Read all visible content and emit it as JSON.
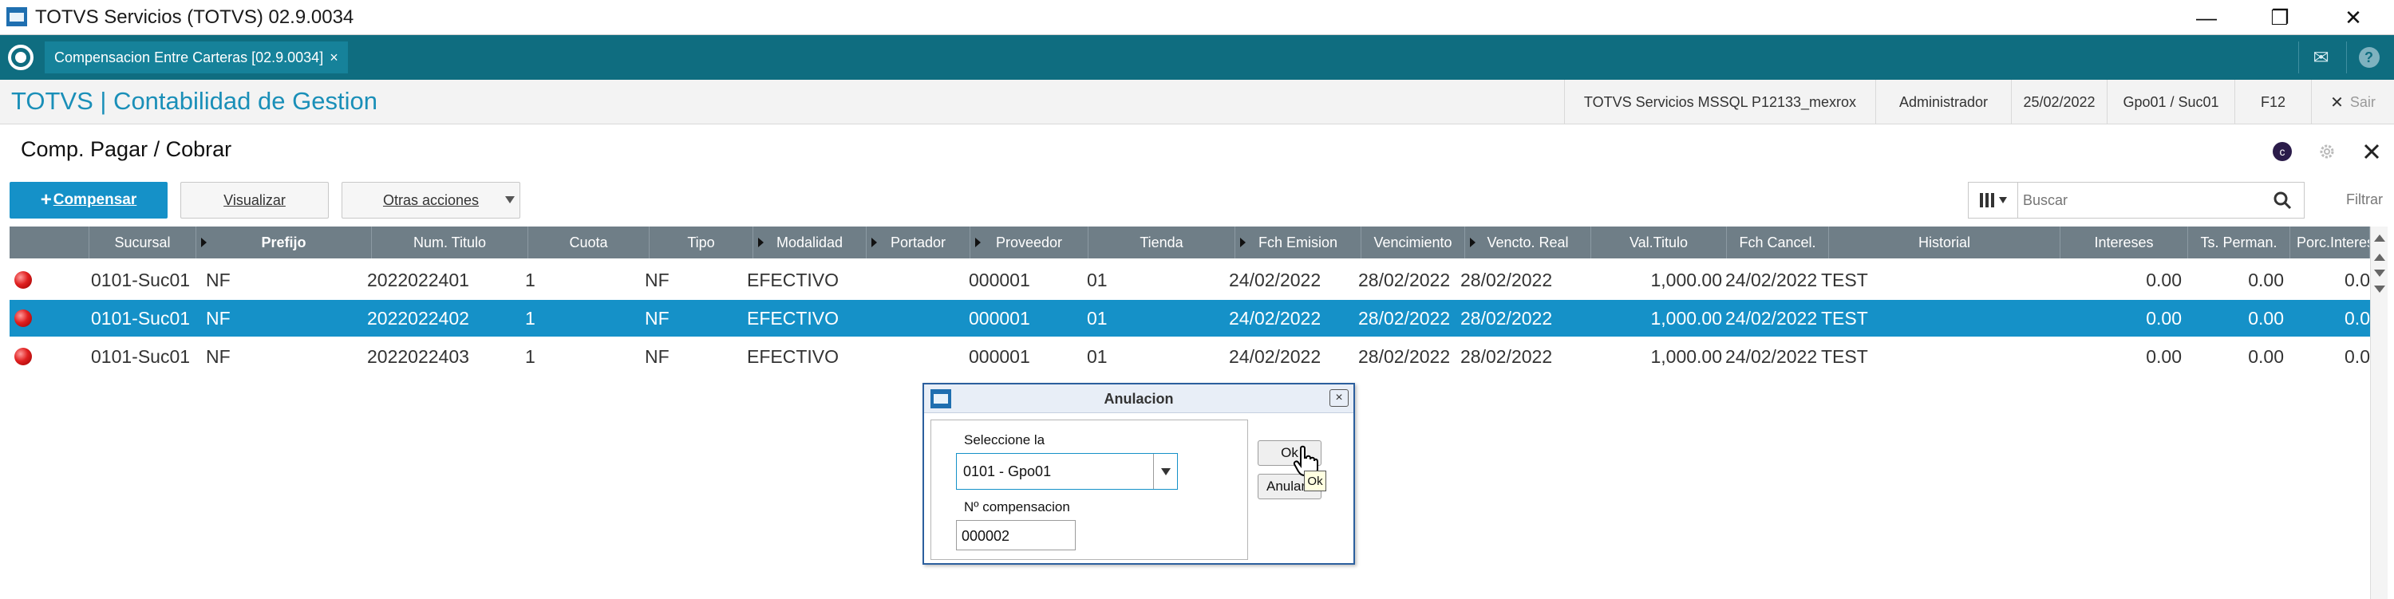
{
  "window": {
    "title": "TOTVS Servicios (TOTVS) 02.9.0034",
    "controls": [
      "—",
      "❐",
      "✕"
    ]
  },
  "tabstrip": {
    "tab_label": "Compensacion Entre Carteras [02.9.0034]",
    "tab_close": "×",
    "mail_icon": "✉",
    "help_icon": "?"
  },
  "module": {
    "title": "TOTVS | Contabilidad de Gestion",
    "env": "TOTVS Servicios MSSQL P12133_mexrox",
    "user": "Administrador",
    "date": "25/02/2022",
    "company": "Gpo01 / Suc01",
    "f12": "F12",
    "exit": "Sair",
    "exit_icon": "✕"
  },
  "page": {
    "title": "Comp. Pagar / Cobrar",
    "c_icon": "c"
  },
  "toolbar": {
    "compensar_plus": "+",
    "compensar_label": "Compensar",
    "visualizar_label": "Visualizar",
    "otras_label": "Otras acciones",
    "search_placeholder": "Buscar",
    "filter_label": "Filtrar"
  },
  "grid": {
    "headers": [
      "Sucursal",
      "Prefijo",
      "Num. Titulo",
      "Cuota",
      "Tipo",
      "Modalidad",
      "Portador",
      "Proveedor",
      "Tienda",
      "Fch Emision",
      "Vencimiento",
      "Vencto. Real",
      "Val.Titulo",
      "Fch Cancel.",
      "Historial",
      "Intereses",
      "Ts. Perman.",
      "Porc.Interes"
    ],
    "rows": [
      {
        "sucursal": "0101-Suc01",
        "prefijo": "NF",
        "num": "2022022401",
        "cuota": "1",
        "tipo": "NF",
        "modalidad": "EFECTIVO",
        "portador": "",
        "proveedor": "000001",
        "tienda": "01",
        "emision": "24/02/2022",
        "vencimiento": "28/02/2022",
        "vencto_real": "28/02/2022",
        "valor": "1,000.00",
        "cancel": "24/02/2022",
        "historial": "TEST",
        "intereses": "0.00",
        "perman": "0.00",
        "porc": "0.0",
        "selected": false
      },
      {
        "sucursal": "0101-Suc01",
        "prefijo": "NF",
        "num": "2022022402",
        "cuota": "1",
        "tipo": "NF",
        "modalidad": "EFECTIVO",
        "portador": "",
        "proveedor": "000001",
        "tienda": "01",
        "emision": "24/02/2022",
        "vencimiento": "28/02/2022",
        "vencto_real": "28/02/2022",
        "valor": "1,000.00",
        "cancel": "24/02/2022",
        "historial": "TEST",
        "intereses": "0.00",
        "perman": "0.00",
        "porc": "0.0",
        "selected": true
      },
      {
        "sucursal": "0101-Suc01",
        "prefijo": "NF",
        "num": "2022022403",
        "cuota": "1",
        "tipo": "NF",
        "modalidad": "EFECTIVO",
        "portador": "",
        "proveedor": "000001",
        "tienda": "01",
        "emision": "24/02/2022",
        "vencimiento": "28/02/2022",
        "vencto_real": "28/02/2022",
        "valor": "1,000.00",
        "cancel": "24/02/2022",
        "historial": "TEST",
        "intereses": "0.00",
        "perman": "0.00",
        "porc": "0.0",
        "selected": false
      }
    ]
  },
  "dialog": {
    "title": "Anulacion",
    "close": "×",
    "select_label": "Seleccione la",
    "select_value": "0101 - Gpo01",
    "comp_label": "Nº compensacion",
    "comp_value": "000002",
    "ok_label": "Ok",
    "anular_label": "Anular",
    "tooltip": "Ok"
  },
  "colors": {
    "tab_teal": "#0f6d80",
    "module_blue": "#1a8fb8",
    "primary_button": "#1591c8",
    "selected_row": "#1591c8",
    "grid_header": "#6f7e87",
    "status_red": "#e02020"
  }
}
